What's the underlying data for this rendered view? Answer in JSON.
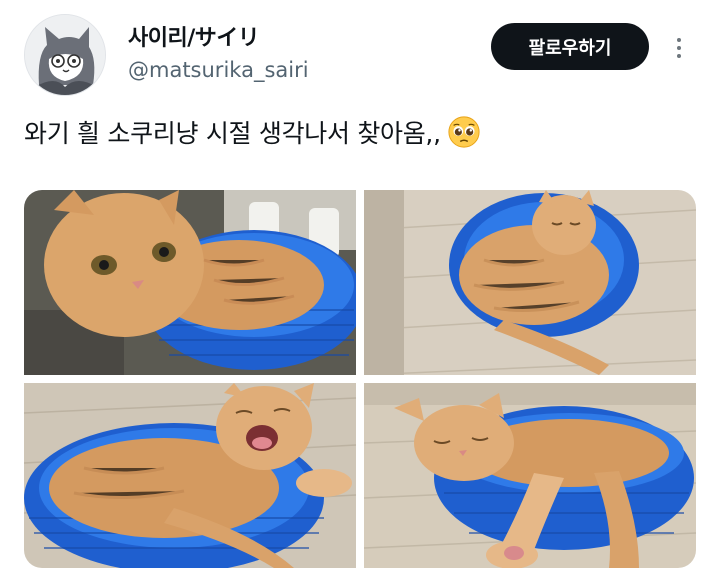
{
  "user": {
    "display_name": "사이리/サイリ",
    "handle": "@matsurika_sairi",
    "avatar_icon": "cartoon-cat-avatar"
  },
  "actions": {
    "follow_label": "팔로우하기",
    "more_icon": "vertical-ellipsis-icon"
  },
  "tweet": {
    "text": "와기 흴 소쿠리냥 시절 생각나서 찾아옴,,",
    "emoji": "pleading-face-emoji"
  },
  "media": {
    "photos": [
      {
        "subject": "orange kitten sitting in blue basket, looking at camera"
      },
      {
        "subject": "orange kitten curled asleep in blue basket on wood floor"
      },
      {
        "subject": "orange kitten yawning in blue basket"
      },
      {
        "subject": "orange kitten sleeping in blue basket with paw stretched out"
      }
    ]
  },
  "colors": {
    "text": "#0f1419",
    "secondary": "#536471",
    "button_bg": "#0f1419",
    "button_text": "#ffffff",
    "basket": "#2463d6",
    "cat": "#d9a26a"
  }
}
